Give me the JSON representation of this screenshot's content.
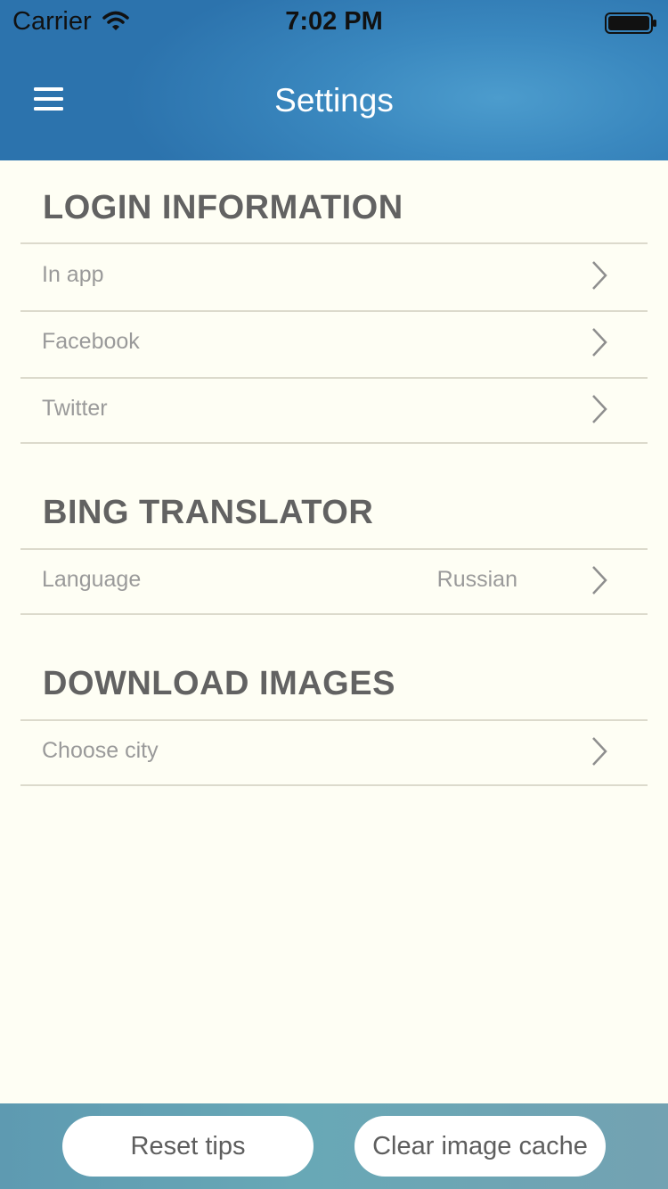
{
  "status_bar": {
    "carrier": "Carrier",
    "time": "7:02 PM",
    "icons": [
      "wifi-icon",
      "battery-icon"
    ]
  },
  "nav_bar": {
    "title": "Settings",
    "menu_icon": "menu-icon",
    "color": "#3a88bf"
  },
  "sections": {
    "login": {
      "title": "LOGIN INFORMATION",
      "items": [
        {
          "label": "In app"
        },
        {
          "label": "Facebook"
        },
        {
          "label": "Twitter"
        }
      ]
    },
    "translator": {
      "title": "BING TRANSLATOR",
      "items": [
        {
          "label": "Language",
          "value": "Russian"
        }
      ]
    },
    "download": {
      "title": "DOWNLOAD IMAGES",
      "items": [
        {
          "label": "Choose city"
        }
      ]
    }
  },
  "footer": {
    "reset_label": "Reset tips",
    "clear_cache_label": "Clear image cache"
  },
  "colors": {
    "background": "#fefef4",
    "section_title": "#626262",
    "row_text": "#9a9a9a",
    "divider": "#dcdacc"
  }
}
